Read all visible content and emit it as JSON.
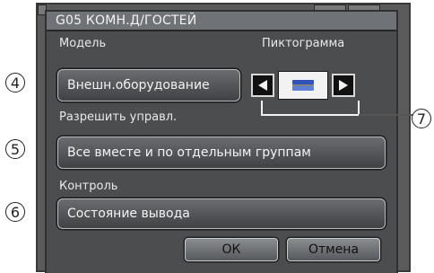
{
  "dialog": {
    "title": "G05 КОМН.Д/ГОСТЕЙ"
  },
  "model": {
    "label": "Модель",
    "value": "Внешн.оборудование"
  },
  "pictogram": {
    "label": "Пиктограмма"
  },
  "control_permission": {
    "label": "Разрешить управл.",
    "value": "Все вместе и по отдельным группам"
  },
  "monitoring": {
    "label": "Контроль",
    "value": "Состояние вывода"
  },
  "footer": {
    "ok_label": "ОК",
    "cancel_label": "Отмена"
  },
  "callouts": {
    "c4": "4",
    "c5": "5",
    "c6": "6",
    "c7": "7"
  },
  "colors": {
    "panel_bg": "#4b4d4f",
    "title_bg": "#6f7276",
    "icon_accent": "#2f53b8"
  }
}
